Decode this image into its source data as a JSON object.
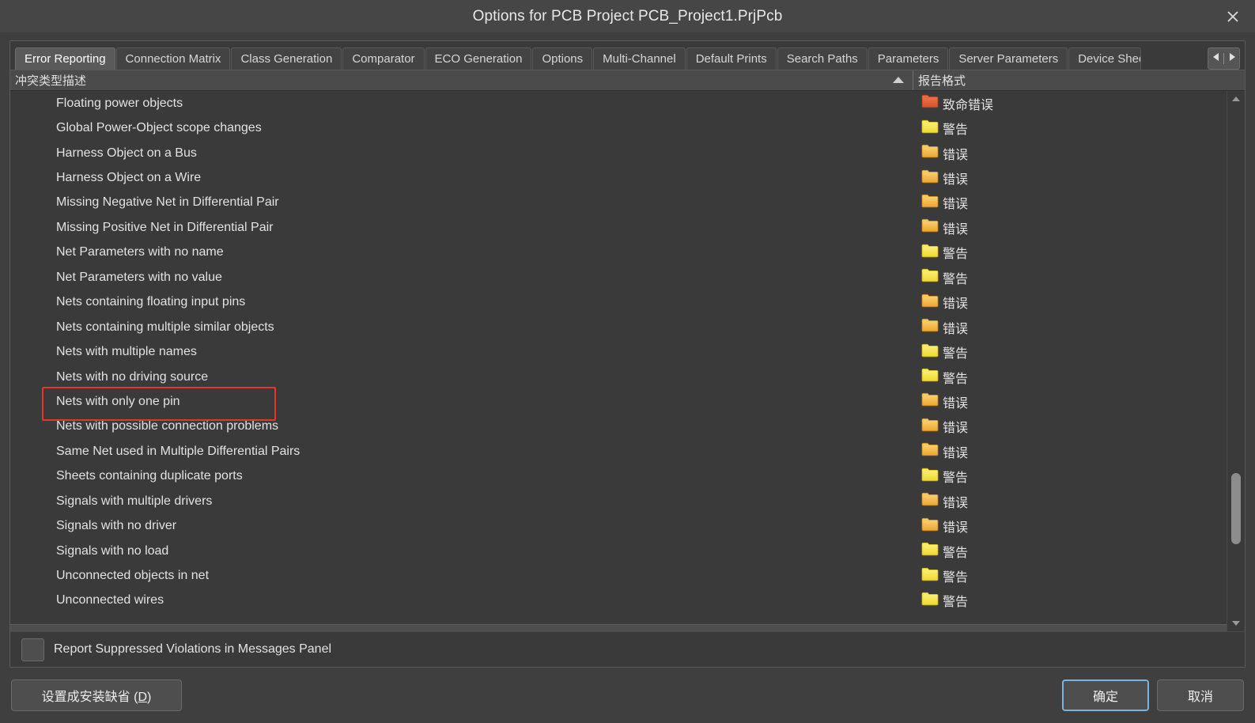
{
  "window": {
    "title": "Options for PCB Project PCB_Project1.PrjPcb",
    "close_icon": "close-icon"
  },
  "tabs": [
    {
      "label": "Error Reporting",
      "active": true
    },
    {
      "label": "Connection Matrix",
      "active": false
    },
    {
      "label": "Class Generation",
      "active": false
    },
    {
      "label": "Comparator",
      "active": false
    },
    {
      "label": "ECO Generation",
      "active": false
    },
    {
      "label": "Options",
      "active": false
    },
    {
      "label": "Multi-Channel",
      "active": false
    },
    {
      "label": "Default Prints",
      "active": false
    },
    {
      "label": "Search Paths",
      "active": false
    },
    {
      "label": "Parameters",
      "active": false
    },
    {
      "label": "Server Parameters",
      "active": false
    },
    {
      "label": "Device Shee",
      "active": false,
      "truncated": true
    }
  ],
  "tab_scroller": {
    "left_arrow_icon": "triangle-left-icon",
    "right_arrow_icon": "triangle-right-icon"
  },
  "grid": {
    "columns": [
      {
        "label": "冲突类型描述",
        "sort": "ascending",
        "sort_icon": "sort-ascending-icon"
      },
      {
        "label": "报告格式"
      }
    ],
    "rows": [
      {
        "description": "Floating power objects",
        "format": "致命错误",
        "severity": "fatal"
      },
      {
        "description": "Global Power-Object scope changes",
        "format": "警告",
        "severity": "warning"
      },
      {
        "description": "Harness Object on a Bus",
        "format": "错误",
        "severity": "error"
      },
      {
        "description": "Harness Object on a Wire",
        "format": "错误",
        "severity": "error"
      },
      {
        "description": "Missing Negative Net in Differential Pair",
        "format": "错误",
        "severity": "error"
      },
      {
        "description": "Missing Positive Net in Differential Pair",
        "format": "错误",
        "severity": "error"
      },
      {
        "description": "Net Parameters with no name",
        "format": "警告",
        "severity": "warning"
      },
      {
        "description": "Net Parameters with no value",
        "format": "警告",
        "severity": "warning"
      },
      {
        "description": "Nets containing floating input pins",
        "format": "错误",
        "severity": "error"
      },
      {
        "description": "Nets containing multiple similar objects",
        "format": "错误",
        "severity": "error"
      },
      {
        "description": "Nets with multiple names",
        "format": "警告",
        "severity": "warning"
      },
      {
        "description": "Nets with no driving source",
        "format": "警告",
        "severity": "warning"
      },
      {
        "description": "Nets with only one pin",
        "format": "错误",
        "severity": "error",
        "highlighted": true
      },
      {
        "description": "Nets with possible connection problems",
        "format": "错误",
        "severity": "error"
      },
      {
        "description": "Same Net used in Multiple Differential Pairs",
        "format": "错误",
        "severity": "error"
      },
      {
        "description": "Sheets containing duplicate ports",
        "format": "警告",
        "severity": "warning"
      },
      {
        "description": "Signals with multiple drivers",
        "format": "错误",
        "severity": "error"
      },
      {
        "description": "Signals with no driver",
        "format": "错误",
        "severity": "error"
      },
      {
        "description": "Signals with no load",
        "format": "警告",
        "severity": "warning"
      },
      {
        "description": "Unconnected objects in net",
        "format": "警告",
        "severity": "warning"
      },
      {
        "description": "Unconnected wires",
        "format": "警告",
        "severity": "warning"
      }
    ]
  },
  "scrollbar": {
    "up_arrow_icon": "triangle-up-icon",
    "down_arrow_icon": "triangle-down-icon"
  },
  "footer": {
    "suppressed_checkbox_label": "Report Suppressed Violations in Messages Panel",
    "suppressed_checkbox_checked": false,
    "set_default_label": "设置成安装缺省 (D)",
    "set_default_mnemonic": "D",
    "ok_label": "确定",
    "cancel_label": "取消"
  },
  "colors": {
    "accent_focus": "#7ab3e0",
    "highlight_box": "#e8342a",
    "severity_fatal": "#e8603a",
    "severity_error": "#f5c24a",
    "severity_warning": "#f5e54a",
    "window_bg": "#3f3f3f",
    "grid_bg": "#3a3a3a"
  }
}
